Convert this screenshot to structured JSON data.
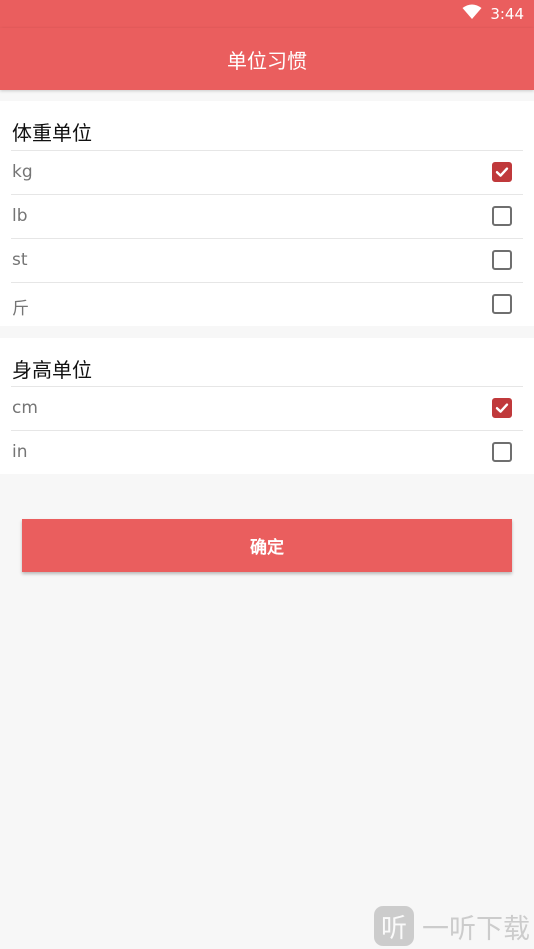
{
  "status_bar": {
    "time": "3:44",
    "icons": [
      "wifi-icon"
    ]
  },
  "app_bar": {
    "title": "单位习惯"
  },
  "weight_section": {
    "title": "体重单位",
    "options": [
      {
        "label": "kg",
        "checked": true
      },
      {
        "label": "lb",
        "checked": false
      },
      {
        "label": "st",
        "checked": false
      },
      {
        "label": "斤",
        "checked": false
      }
    ]
  },
  "height_section": {
    "title": "身高单位",
    "options": [
      {
        "label": "cm",
        "checked": true
      },
      {
        "label": "in",
        "checked": false
      }
    ]
  },
  "confirm_button": {
    "label": "确定"
  },
  "watermark": {
    "icon_glyph": "听",
    "text": "一听下载"
  },
  "colors": {
    "primary": "#ea5e5e",
    "checkbox_checked": "#c0393b",
    "background": "#f7f7f7"
  }
}
